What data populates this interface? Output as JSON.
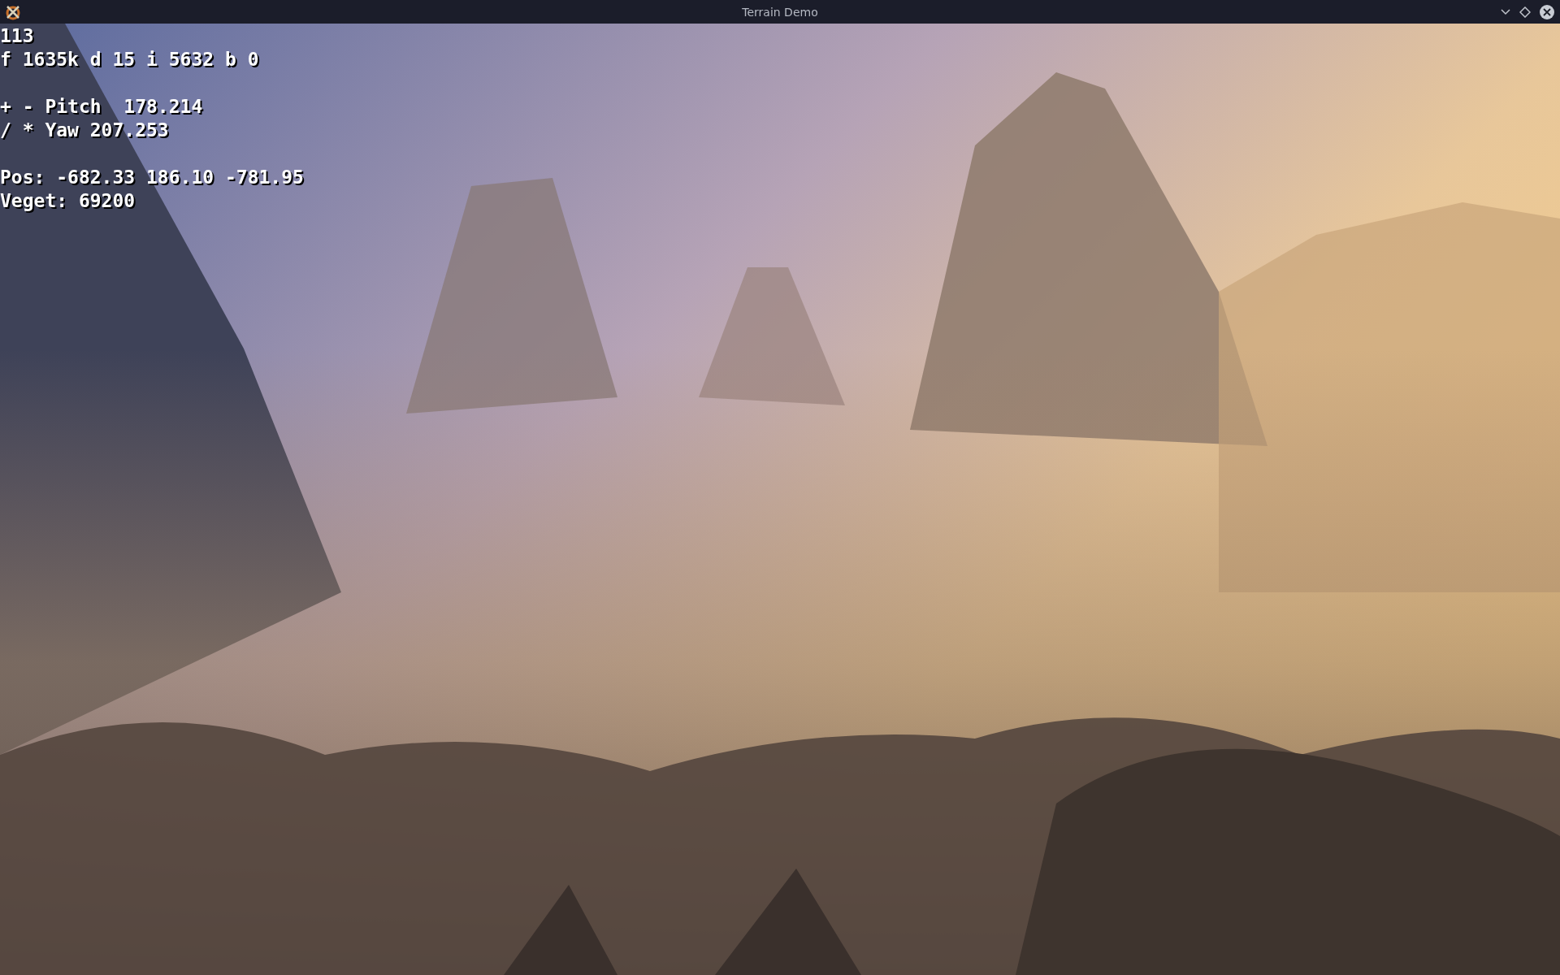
{
  "window": {
    "title": "Terrain Demo"
  },
  "hud": {
    "groups": [
      [
        "113",
        "f 1635k d 15 i 5632 b 0"
      ],
      [
        "+ - Pitch  178.214",
        "/ * Yaw 207.253"
      ],
      [
        "Pos: -682.33 186.10 -781.95",
        "Veget: 69200"
      ]
    ]
  }
}
